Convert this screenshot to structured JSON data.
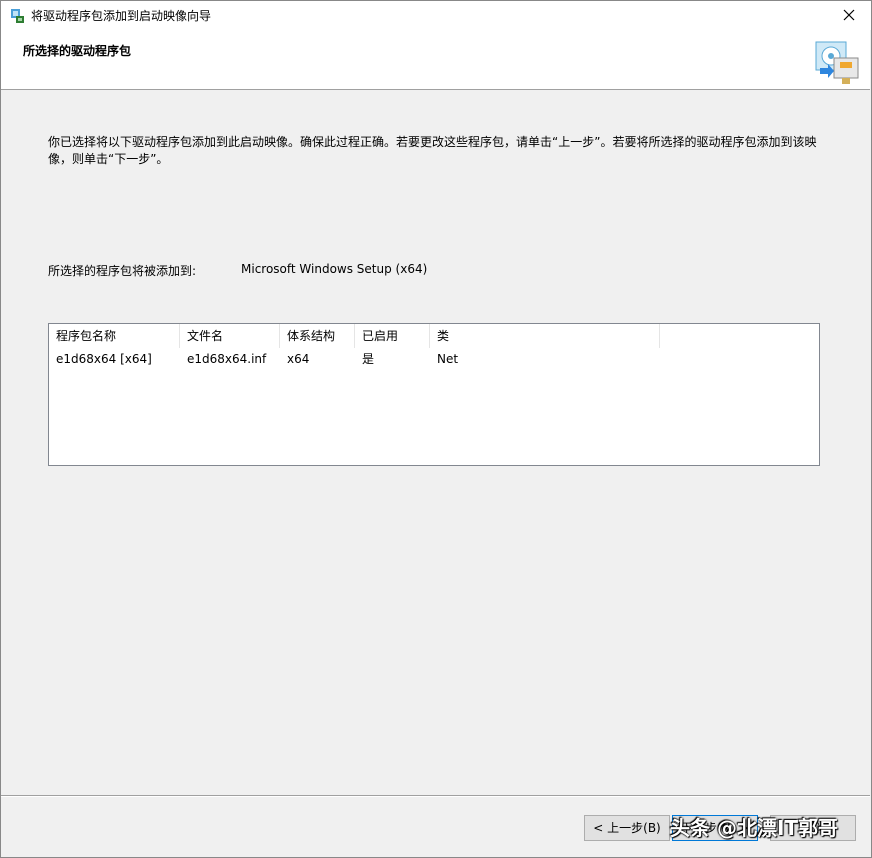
{
  "window": {
    "title": "将驱动程序包添加到启动映像向导"
  },
  "header": {
    "title": "所选择的驱动程序包"
  },
  "intro": {
    "text": "你已选择将以下驱动程序包添加到此启动映像。确保此过程正确。若要更改这些程序包，请单击“上一步”。若要将所选择的驱动程序包添加到该映像，则单击“下一步”。"
  },
  "target": {
    "label": "所选择的程序包将被添加到:",
    "value": "Microsoft Windows Setup (x64)"
  },
  "table": {
    "columns": [
      "程序包名称",
      "文件名",
      "体系结构",
      "已启用",
      "类"
    ],
    "rows": [
      [
        "e1d68x64 [x64]",
        "e1d68x64.inf",
        "x64",
        "是",
        "Net"
      ]
    ]
  },
  "buttons": {
    "back": "< 上一步(B)",
    "next": "下一步(N) >",
    "cancel": "取消"
  },
  "watermark": "头条 @北漂IT郭哥"
}
